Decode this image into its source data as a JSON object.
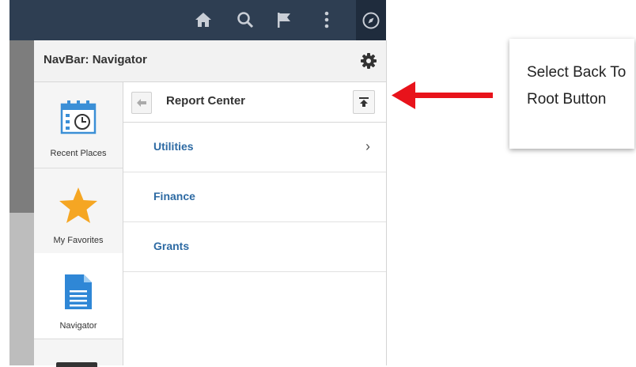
{
  "navbar": {
    "title": "NavBar: Navigator"
  },
  "tiles": [
    {
      "label": "Recent Places"
    },
    {
      "label": "My Favorites"
    },
    {
      "label": "Navigator"
    }
  ],
  "breadcrumb": {
    "title": "Report Center"
  },
  "menu_items": [
    {
      "label": "Utilities",
      "has_children": true,
      "chevron": "›"
    },
    {
      "label": "Finance",
      "has_children": false
    },
    {
      "label": "Grants",
      "has_children": false
    }
  ],
  "callout": {
    "text": "Select Back To Root Button"
  },
  "icons": [
    "home-icon",
    "search-icon",
    "flag-icon",
    "more-icon",
    "compass-icon",
    "gear-icon",
    "clock-calendar-icon",
    "star-icon",
    "document-icon",
    "back-arrow-icon",
    "back-to-root-icon"
  ],
  "colors": {
    "header_bg": "#2e3e52",
    "link": "#2d6aa3",
    "star": "#f5a623",
    "doc": "#2f87d6",
    "arrow": "#e8131b"
  }
}
